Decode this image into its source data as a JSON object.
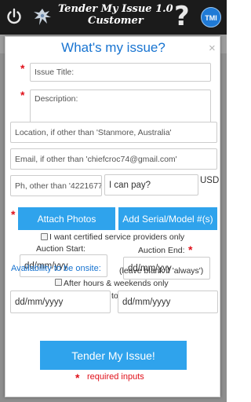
{
  "header": {
    "title_line1": "Tender My Issue 1.0",
    "title_line2": "Customer",
    "tmi_badge": "TMI",
    "help_glyph": "?"
  },
  "modal": {
    "title": "What's my issue?",
    "close_glyph": "×",
    "issue_title_placeholder": "Issue Title:",
    "description_placeholder": "Description:",
    "location_placeholder": "Location, if other than 'Stanmore, Australia'",
    "email_placeholder": "Email, if other than 'chiefcroc74@gmail.com'",
    "phone_placeholder": "Ph, other than '4221677",
    "price_placeholder": "I can pay?",
    "currency": "USD",
    "attach_photos_label": "Attach Photos",
    "add_serial_label": "Add Serial/Model #(s)",
    "certified_label": "I want certified service providers only",
    "auction_start_label": "Auction Start:",
    "auction_end_label": "Auction End:",
    "auction_start_value": "dd/mm/yyy",
    "auction_end_value": "dd/mm/yyy",
    "availability_label": "Availability to be onsite:",
    "availability_hint": "(leave blank if 'always')",
    "after_hours_label": "After hours & weekends only",
    "to_label": "to",
    "avail_from_value": "dd/mm/yyyy",
    "avail_to_value": "dd/mm/yyyy",
    "submit_label": "Tender My Issue!",
    "required_note": "required inputs",
    "required_marker": "*"
  }
}
